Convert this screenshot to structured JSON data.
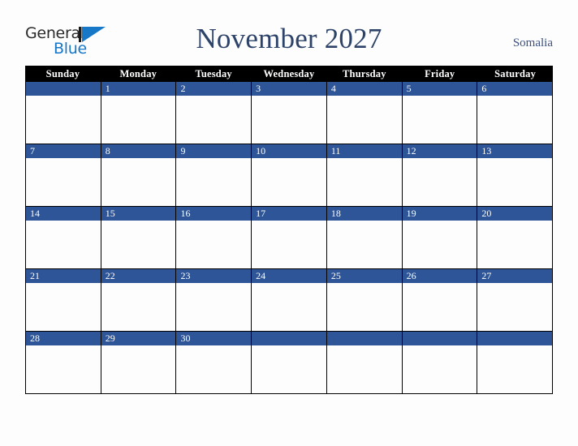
{
  "brand": {
    "word_one": "General",
    "word_two": "Blue",
    "mark": "triangle-logo-mark"
  },
  "header": {
    "title": "November 2027",
    "country": "Somalia"
  },
  "calendar": {
    "day_headers": [
      "Sunday",
      "Monday",
      "Tuesday",
      "Wednesday",
      "Thursday",
      "Friday",
      "Saturday"
    ],
    "weeks": [
      [
        "",
        "1",
        "2",
        "3",
        "4",
        "5",
        "6"
      ],
      [
        "7",
        "8",
        "9",
        "10",
        "11",
        "12",
        "13"
      ],
      [
        "14",
        "15",
        "16",
        "17",
        "18",
        "19",
        "20"
      ],
      [
        "21",
        "22",
        "23",
        "24",
        "25",
        "26",
        "27"
      ],
      [
        "28",
        "29",
        "30",
        "",
        "",
        "",
        ""
      ]
    ]
  },
  "colors": {
    "header_bar": "#000000",
    "date_bar": "#2e5597",
    "title_text": "#2e4369",
    "country_text": "#3c5180",
    "logo_blue": "#1878c8",
    "page_background": "#fdfdfd"
  }
}
